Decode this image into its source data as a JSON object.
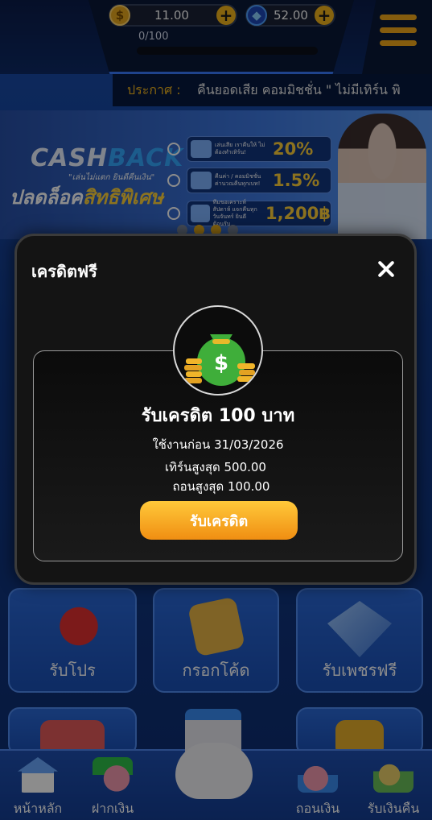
{
  "header": {
    "coins": "11.00",
    "gems": "52.00",
    "progress": "0/100",
    "progress_fraction": 0
  },
  "announcement": {
    "label": "ประกาศ :",
    "text": "คืนยอดเสีย คอมมิชชั่น \" ไม่มีเทิร์น พิ"
  },
  "banner": {
    "title_a": "CASH",
    "title_b": "BACK",
    "tagline": "\"เล่นไม่แตก ยินดีคืนเงิน\"",
    "headline_a": "ปลดล็อค",
    "headline_b": "สิทธิพิเศษ",
    "promos": [
      {
        "desc": "เล่นเสีย เราคืนให้ ไม่ต้องทำเทิร์น!",
        "value": "20%"
      },
      {
        "desc": "คืนค่า / คอมมิชชั่น ค่านวณคืนทุกเบท!",
        "value": "1.5%"
      },
      {
        "desc": "ทีมขอเคราะห์สัปดาห์ แจกคืนทุกวันจันทร์ ยินดีต้อนรับ",
        "value": "1,200฿"
      }
    ]
  },
  "tiles": {
    "receive_promo": "รับโปร",
    "enter_code": "กรอกโค้ด",
    "free_gems": "รับเพชรฟรี"
  },
  "bottom_nav": {
    "home": "หน้าหลัก",
    "deposit": "ฝากเงิน",
    "withdraw": "ถอนเงิน",
    "cashback": "รับเงินคืน"
  },
  "modal": {
    "title": "เครดิตฟรี",
    "heading": "รับเครดิต 100 บาท",
    "expires": "ใช้งานก่อน 31/03/2026",
    "max_turnover": "เทิร์นสูงสุด 500.00",
    "max_withdraw": "ถอนสูงสุด 100.00",
    "claim_label": "รับเครดิต"
  },
  "colors": {
    "accent": "#f2b51c",
    "button_top": "#ffc93a",
    "button_bottom": "#f08e12",
    "modal_bg": "#141414"
  },
  "icons": {
    "coin": "coin-icon",
    "gem": "gem-icon",
    "plus": "plus-icon",
    "menu": "hamburger-menu-icon",
    "close": "close-icon",
    "money_bag": "money-bag-icon"
  }
}
